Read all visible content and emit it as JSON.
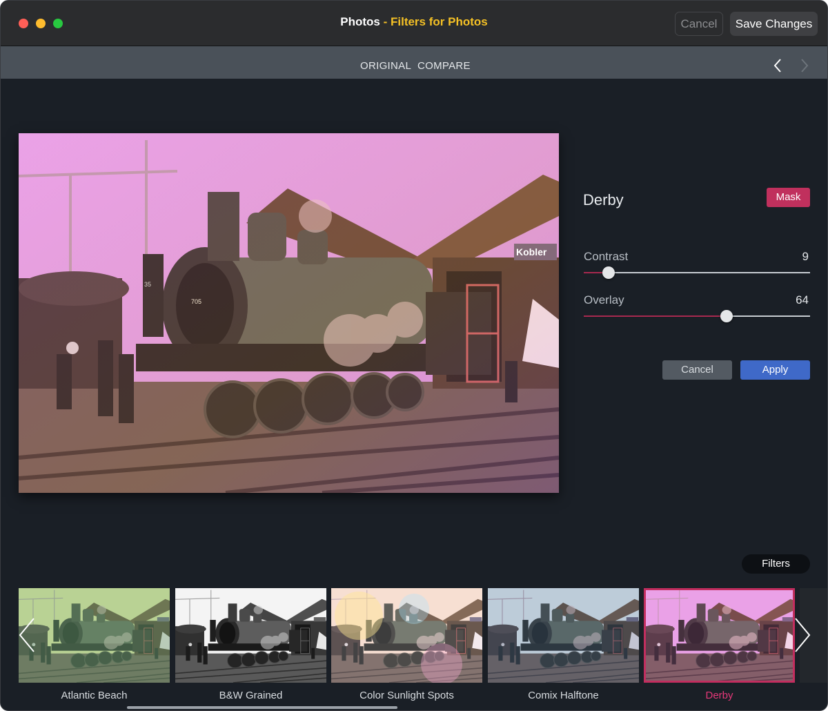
{
  "window": {
    "app_name": "Photos",
    "separator": " - ",
    "extension_name": "Filters for Photos",
    "cancel_label": "Cancel",
    "save_label": "Save Changes"
  },
  "compare_bar": {
    "original_label": "ORIGINAL",
    "compare_label": "COMPARE",
    "prev_icon": "chevron-left-icon",
    "next_icon": "chevron-right-icon"
  },
  "photo": {
    "subject": "steam locomotive",
    "number_plate": "705",
    "sign_text": "Kobler",
    "side_number": "35"
  },
  "panel": {
    "filter_name": "Derby",
    "mask_label": "Mask",
    "sliders": [
      {
        "label": "Contrast",
        "value": "9",
        "level": 0.11
      },
      {
        "label": "Overlay",
        "value": "64",
        "level": 0.63
      }
    ],
    "cancel_label": "Cancel",
    "apply_label": "Apply"
  },
  "filters_tab_label": "Filters",
  "thumbnails": [
    {
      "label": "Atlantic Beach",
      "selected": false
    },
    {
      "label": "B&W Grained",
      "selected": false
    },
    {
      "label": "Color Sunlight Spots",
      "selected": false
    },
    {
      "label": "Comix Halftone",
      "selected": false
    },
    {
      "label": "Derby",
      "selected": true
    }
  ],
  "colors": {
    "accent_yellow": "#f5c125",
    "mask_pink": "#c0305d",
    "apply_blue": "#3f69c8",
    "selected_label": "#e7387a"
  }
}
